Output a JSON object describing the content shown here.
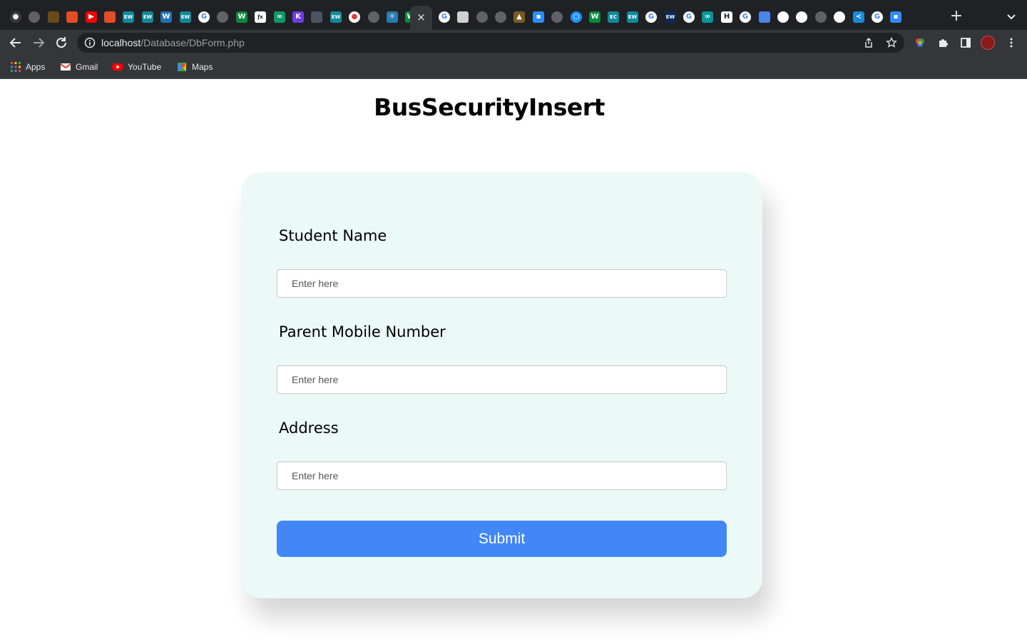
{
  "browser": {
    "address_host": "localhost",
    "address_path": "/Database/DbForm.php",
    "active_tab_close": "×",
    "new_tab": "+",
    "tabs": [
      {
        "icon": "github-icon",
        "color": "#3a3a3a",
        "glyph": "●"
      },
      {
        "icon": "globe-icon",
        "color": "#5f6368",
        "glyph": ""
      },
      {
        "icon": "flame-icon",
        "color": "#6b4a1a",
        "glyph": ""
      },
      {
        "icon": "html5-icon",
        "color": "#e44d26",
        "glyph": ""
      },
      {
        "icon": "youtube-icon",
        "color": "#ff0000",
        "glyph": "▶"
      },
      {
        "icon": "html5-icon",
        "color": "#e44d26",
        "glyph": ""
      },
      {
        "icon": "ew-icon",
        "color": "#0f8a9a",
        "glyph": "EW"
      },
      {
        "icon": "ew-icon",
        "color": "#0f8a9a",
        "glyph": "EW"
      },
      {
        "icon": "wordpress-icon",
        "color": "#2271b1",
        "glyph": "W"
      },
      {
        "icon": "ew-icon",
        "color": "#0f8a9a",
        "glyph": "EW"
      },
      {
        "icon": "google-icon",
        "color": "#ffffff",
        "glyph": "G"
      },
      {
        "icon": "globe-icon",
        "color": "#5f6368",
        "glyph": ""
      },
      {
        "icon": "w-icon",
        "color": "#0a8a3a",
        "glyph": "W"
      },
      {
        "icon": "excel-icon",
        "color": "#ffffff",
        "glyph": "ƒx"
      },
      {
        "icon": "infinity-icon",
        "color": "#0b9a6a",
        "glyph": "∞"
      },
      {
        "icon": "k-icon",
        "color": "#6f3ce0",
        "glyph": "K"
      },
      {
        "icon": "shield-icon",
        "color": "#4a5560",
        "glyph": ""
      },
      {
        "icon": "ew-icon",
        "color": "#0f8a9a",
        "glyph": "EW"
      },
      {
        "icon": "record-icon",
        "color": "#ffffff",
        "glyph": "●"
      },
      {
        "icon": "globe-icon",
        "color": "#5f6368",
        "glyph": ""
      },
      {
        "icon": "react-icon",
        "color": "#2a7ab0",
        "glyph": "⚛"
      },
      {
        "icon": "w-icon",
        "color": "#0a8a3a",
        "glyph": "W"
      },
      {
        "icon": "google-icon",
        "color": "#ffffff",
        "glyph": "G"
      },
      {
        "icon": "image-icon",
        "color": "#d0d0d0",
        "glyph": ""
      },
      {
        "icon": "globe-icon",
        "color": "#5f6368",
        "glyph": ""
      },
      {
        "icon": "globe-icon",
        "color": "#5f6368",
        "glyph": ""
      },
      {
        "icon": "tree-icon",
        "color": "#7a5a20",
        "glyph": "▲"
      },
      {
        "icon": "zoom-icon",
        "color": "#2d8cff",
        "glyph": "▪"
      },
      {
        "icon": "globe-icon",
        "color": "#5f6368",
        "glyph": ""
      },
      {
        "icon": "safari-icon",
        "color": "#1e90ff",
        "glyph": "○"
      },
      {
        "icon": "w-icon",
        "color": "#0a8a3a",
        "glyph": "W"
      },
      {
        "icon": "ec-icon",
        "color": "#0f8a9a",
        "glyph": "EC"
      },
      {
        "icon": "ew-icon",
        "color": "#0f8a9a",
        "glyph": "EW"
      },
      {
        "icon": "google-icon",
        "color": "#ffffff",
        "glyph": "G"
      },
      {
        "icon": "ew-icon",
        "color": "#0a2a5a",
        "glyph": "EW"
      },
      {
        "icon": "google-icon",
        "color": "#ffffff",
        "glyph": "G"
      },
      {
        "icon": "arduino-icon",
        "color": "#00979c",
        "glyph": "∞"
      },
      {
        "icon": "h-icon",
        "color": "#ffffff",
        "glyph": "H"
      },
      {
        "icon": "google-icon",
        "color": "#ffffff",
        "glyph": "G"
      },
      {
        "icon": "folder-icon",
        "color": "#4a86e8",
        "glyph": ""
      },
      {
        "icon": "github-icon",
        "color": "#ffffff",
        "glyph": ""
      },
      {
        "icon": "github-icon",
        "color": "#ffffff",
        "glyph": ""
      },
      {
        "icon": "globe-icon",
        "color": "#5f6368",
        "glyph": ""
      },
      {
        "icon": "github-icon",
        "color": "#ffffff",
        "glyph": ""
      },
      {
        "icon": "vscode-icon",
        "color": "#1a8ad4",
        "glyph": "≺"
      },
      {
        "icon": "google-icon",
        "color": "#ffffff",
        "glyph": "G"
      },
      {
        "icon": "zoom-icon",
        "color": "#2d8cff",
        "glyph": "▪"
      }
    ]
  },
  "bookmarks": [
    {
      "label": "Apps",
      "icon": "apps-grid-icon"
    },
    {
      "label": "Gmail",
      "icon": "gmail-icon"
    },
    {
      "label": "YouTube",
      "icon": "youtube-icon"
    },
    {
      "label": "Maps",
      "icon": "maps-icon"
    }
  ],
  "page": {
    "title": "BusSecurityInsert"
  },
  "form": {
    "fields": [
      {
        "label": "Student Name",
        "placeholder": "Enter here",
        "value": ""
      },
      {
        "label": "Parent Mobile Number",
        "placeholder": "Enter here",
        "value": ""
      },
      {
        "label": "Address",
        "placeholder": "Enter here",
        "value": ""
      }
    ],
    "submit_label": "Submit"
  },
  "colors": {
    "card_background": "#ebfaf6",
    "submit_button": "#4287f5",
    "chrome_dark": "#202124",
    "chrome_toolbar": "#35363a"
  }
}
